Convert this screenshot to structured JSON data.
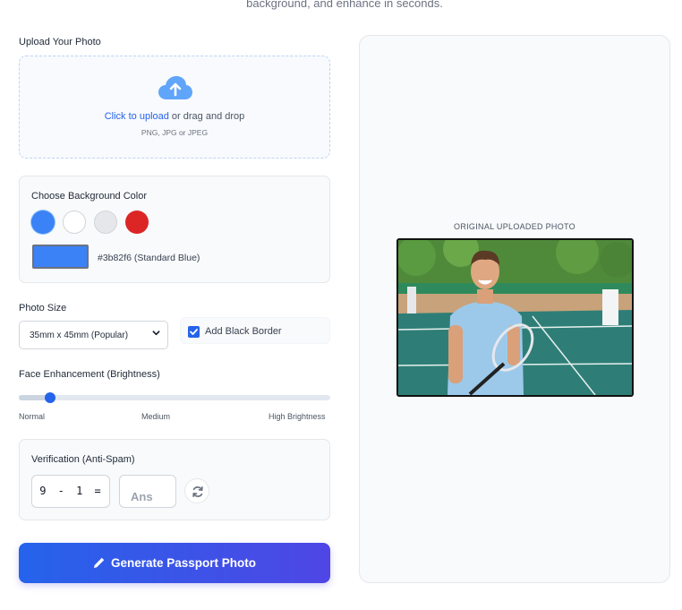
{
  "header": {
    "subtitle": "background, and enhance in seconds."
  },
  "upload": {
    "label": "Upload Your Photo",
    "link_text": "Click to upload",
    "rest_text": " or drag and drop",
    "formats": "PNG, JPG or JPEG",
    "icon": "cloud-upload-icon"
  },
  "background": {
    "label": "Choose Background Color",
    "swatches": [
      "#3b82f6",
      "#ffffff",
      "#e5e7eb",
      "#dc2626"
    ],
    "selected_text": "#3b82f6 (Standard Blue)"
  },
  "size": {
    "label": "Photo Size",
    "selected": "35mm x 45mm (Popular)",
    "border_option": "Add Black Border",
    "border_checked": true
  },
  "enhancement": {
    "label": "Face Enhancement (Brightness)",
    "level_fraction": 0.1,
    "ticks": [
      "Normal",
      "Medium",
      "High Brightness"
    ]
  },
  "verification": {
    "label": "Verification (Anti-Spam)",
    "challenge": "9 - 1 =",
    "answer_placeholder": "Ans"
  },
  "generate": {
    "label": "Generate Passport Photo",
    "icon": "pencil-icon"
  },
  "preview": {
    "label": "ORIGINAL UPLOADED PHOTO"
  },
  "colors": {
    "accent": "#2563eb",
    "gradient_end": "#4f46e5"
  }
}
